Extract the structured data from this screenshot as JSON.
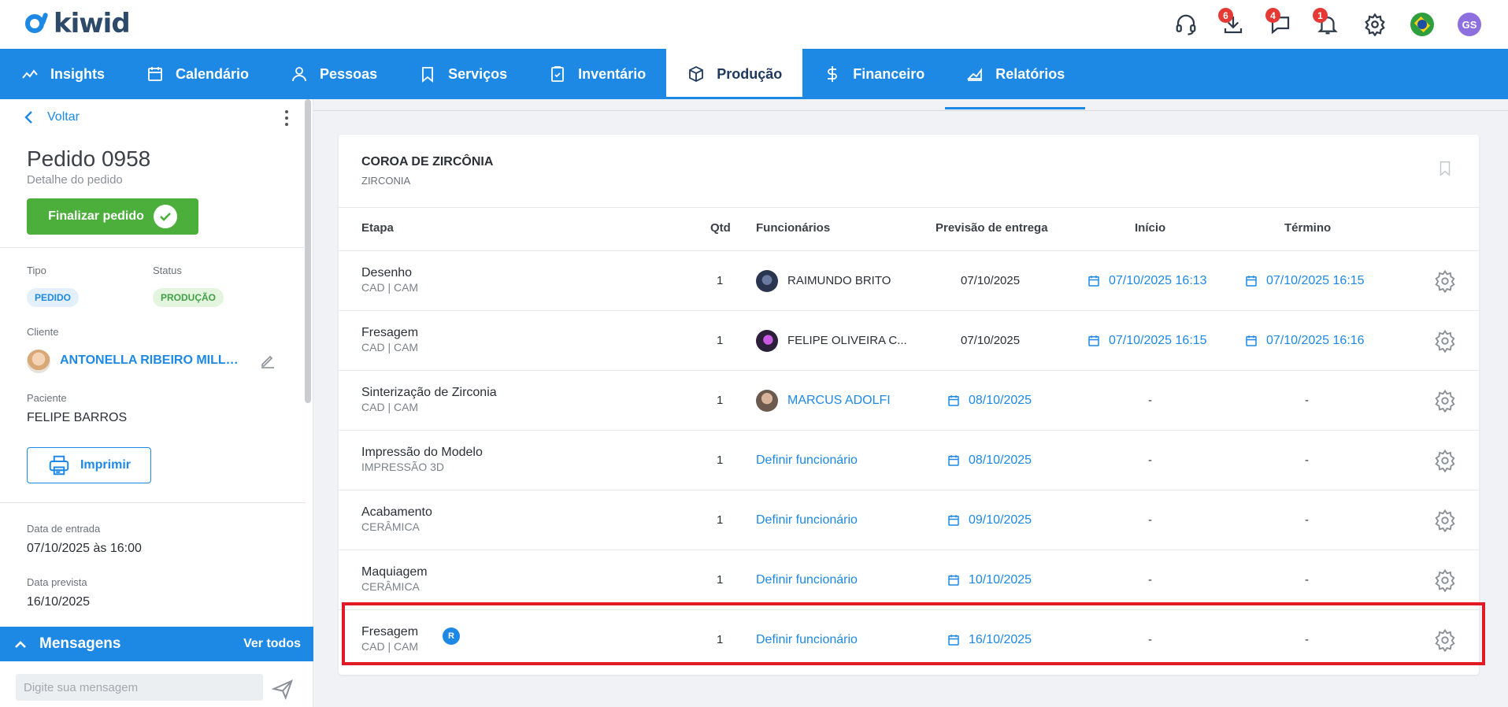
{
  "logo": {
    "text": "kiwid"
  },
  "top_bar": {
    "badges": {
      "downloads": "6",
      "messages": "4",
      "notifications": "1"
    },
    "user_initials": "GS"
  },
  "nav": {
    "items": [
      {
        "label": "Insights",
        "icon": "chart-line-icon"
      },
      {
        "label": "Calendário",
        "icon": "calendar-icon"
      },
      {
        "label": "Pessoas",
        "icon": "person-icon"
      },
      {
        "label": "Serviços",
        "icon": "tooth-icon"
      },
      {
        "label": "Inventário",
        "icon": "clipboard-check-icon"
      },
      {
        "label": "Produção",
        "icon": "box-icon",
        "active": true
      },
      {
        "label": "Financeiro",
        "icon": "dollar-icon"
      },
      {
        "label": "Relatórios",
        "icon": "chart-area-icon"
      }
    ]
  },
  "sidebar": {
    "back_label": "Voltar",
    "order_title": "Pedido 0958",
    "order_subtitle": "Detalhe do pedido",
    "finish_label": "Finalizar pedido",
    "tipo_label": "Tipo",
    "tipo_value": "PEDIDO",
    "status_label": "Status",
    "status_value": "PRODUÇÃO",
    "cliente_label": "Cliente",
    "cliente_value": "ANTONELLA RIBEIRO MILLER",
    "paciente_label": "Paciente",
    "paciente_value": "FELIPE BARROS",
    "print_label": "Imprimir",
    "entrada_label": "Data de entrada",
    "entrada_value": "07/10/2025 às 16:00",
    "prevista_label": "Data prevista",
    "prevista_value": "16/10/2025",
    "messages_title": "Mensagens",
    "messages_all": "Ver todos",
    "message_placeholder": "Digite sua mensagem"
  },
  "product": {
    "title": "COROA DE ZIRCÔNIA",
    "subtitle": "ZIRCONIA"
  },
  "table": {
    "headers": {
      "etapa": "Etapa",
      "qtd": "Qtd",
      "funcionarios": "Funcionários",
      "previsao": "Previsão de entrega",
      "inicio": "Início",
      "termino": "Término"
    },
    "rows": [
      {
        "stage": "Desenho",
        "sub": "CAD | CAM",
        "qty": "1",
        "employee": "RAIMUNDO BRITO",
        "employee_type": "assigned",
        "forecast": "07/10/2025",
        "forecast_link": false,
        "start": "07/10/2025 16:13",
        "end": "07/10/2025 16:15"
      },
      {
        "stage": "Fresagem",
        "sub": "CAD | CAM",
        "qty": "1",
        "employee": "FELIPE OLIVEIRA C...",
        "employee_type": "assigned",
        "forecast": "07/10/2025",
        "forecast_link": false,
        "start": "07/10/2025 16:15",
        "end": "07/10/2025 16:16"
      },
      {
        "stage": "Sinterização de Zirconia",
        "sub": "CAD | CAM",
        "qty": "1",
        "employee": "MARCUS ADOLFI",
        "employee_type": "link-avatar",
        "forecast": "08/10/2025",
        "forecast_link": true,
        "start": "-",
        "end": "-"
      },
      {
        "stage": "Impressão do Modelo",
        "sub": "IMPRESSÃO 3D",
        "qty": "1",
        "employee": "Definir funcionário",
        "employee_type": "define",
        "forecast": "08/10/2025",
        "forecast_link": true,
        "start": "-",
        "end": "-"
      },
      {
        "stage": "Acabamento",
        "sub": "CERÂMICA",
        "qty": "1",
        "employee": "Definir funcionário",
        "employee_type": "define",
        "forecast": "09/10/2025",
        "forecast_link": true,
        "start": "-",
        "end": "-"
      },
      {
        "stage": "Maquiagem",
        "sub": "CERÂMICA",
        "qty": "1",
        "employee": "Definir funcionário",
        "employee_type": "define",
        "forecast": "10/10/2025",
        "forecast_link": true,
        "start": "-",
        "end": "-"
      },
      {
        "stage": "Fresagem",
        "sub": "CAD | CAM",
        "qty": "1",
        "badge": "R",
        "employee": "Definir funcionário",
        "employee_type": "define",
        "forecast": "16/10/2025",
        "forecast_link": true,
        "start": "-",
        "end": "-",
        "highlighted": true
      }
    ]
  },
  "colors": {
    "primary": "#1e88e5",
    "success": "#4caf3b",
    "highlight_border": "#e01b24",
    "badge": "#e53935"
  }
}
